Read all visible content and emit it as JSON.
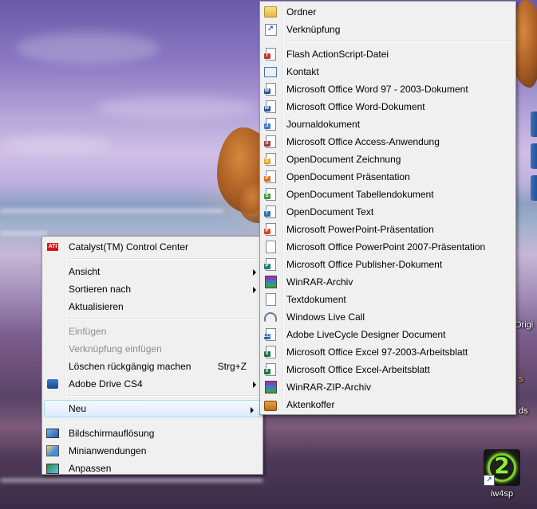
{
  "desktop": {
    "edge_texts": [
      "Origi",
      "ds",
      "s"
    ],
    "icon_label": "iw4sp",
    "icon_glyph": "2"
  },
  "context_menu": {
    "catalyst": "Catalyst(TM) Control Center",
    "view": "Ansicht",
    "sort_by": "Sortieren nach",
    "refresh": "Aktualisieren",
    "paste": "Einfügen",
    "paste_shortcut": "Verknüpfung einfügen",
    "undo_delete": "Löschen rückgängig machen",
    "undo_delete_shortcut": "Strg+Z",
    "adobe_drive": "Adobe Drive CS4",
    "new": "Neu",
    "screen_resolution": "Bildschirmauflösung",
    "gadgets": "Minianwendungen",
    "personalize": "Anpassen"
  },
  "submenu_new": {
    "items": [
      {
        "label": "Ordner",
        "icon": "folder-icon"
      },
      {
        "label": "Verknüpfung",
        "icon": "shortcut-icon"
      },
      {
        "label": "Flash ActionScript-Datei",
        "icon": "flash-file-icon"
      },
      {
        "label": "Kontakt",
        "icon": "contact-icon"
      },
      {
        "label": "Microsoft Office Word 97 - 2003-Dokument",
        "icon": "word-doc-icon"
      },
      {
        "label": "Microsoft Office Word-Dokument",
        "icon": "word-docx-icon"
      },
      {
        "label": "Journaldokument",
        "icon": "journal-icon"
      },
      {
        "label": "Microsoft Office Access-Anwendung",
        "icon": "access-icon"
      },
      {
        "label": "OpenDocument Zeichnung",
        "icon": "odg-icon"
      },
      {
        "label": "OpenDocument Präsentation",
        "icon": "odp-icon"
      },
      {
        "label": "OpenDocument Tabellendokument",
        "icon": "ods-icon"
      },
      {
        "label": "OpenDocument Text",
        "icon": "odt-icon"
      },
      {
        "label": "Microsoft PowerPoint-Präsentation",
        "icon": "powerpoint-icon"
      },
      {
        "label": "Microsoft Office PowerPoint 2007-Präsentation",
        "icon": "blank-file-icon"
      },
      {
        "label": "Microsoft Office Publisher-Dokument",
        "icon": "publisher-icon"
      },
      {
        "label": "WinRAR-Archiv",
        "icon": "winrar-icon"
      },
      {
        "label": "Textdokument",
        "icon": "text-file-icon"
      },
      {
        "label": "Windows Live Call",
        "icon": "live-call-icon"
      },
      {
        "label": "Adobe LiveCycle Designer Document",
        "icon": "livecycle-icon"
      },
      {
        "label": "Microsoft Office Excel 97-2003-Arbeitsblatt",
        "icon": "excel-xls-icon"
      },
      {
        "label": "Microsoft Office Excel-Arbeitsblatt",
        "icon": "excel-xlsx-icon"
      },
      {
        "label": "WinRAR-ZIP-Archiv",
        "icon": "winrar-zip-icon"
      },
      {
        "label": "Aktenkoffer",
        "icon": "briefcase-icon"
      }
    ]
  },
  "colors": {
    "menu_bg": "#f0f0f0",
    "highlight_border": "#a8d8eb",
    "word_blue": "#2b5797",
    "excel_green": "#1e7145",
    "powerpoint_orange": "#d24726",
    "access_red": "#a4373a"
  }
}
